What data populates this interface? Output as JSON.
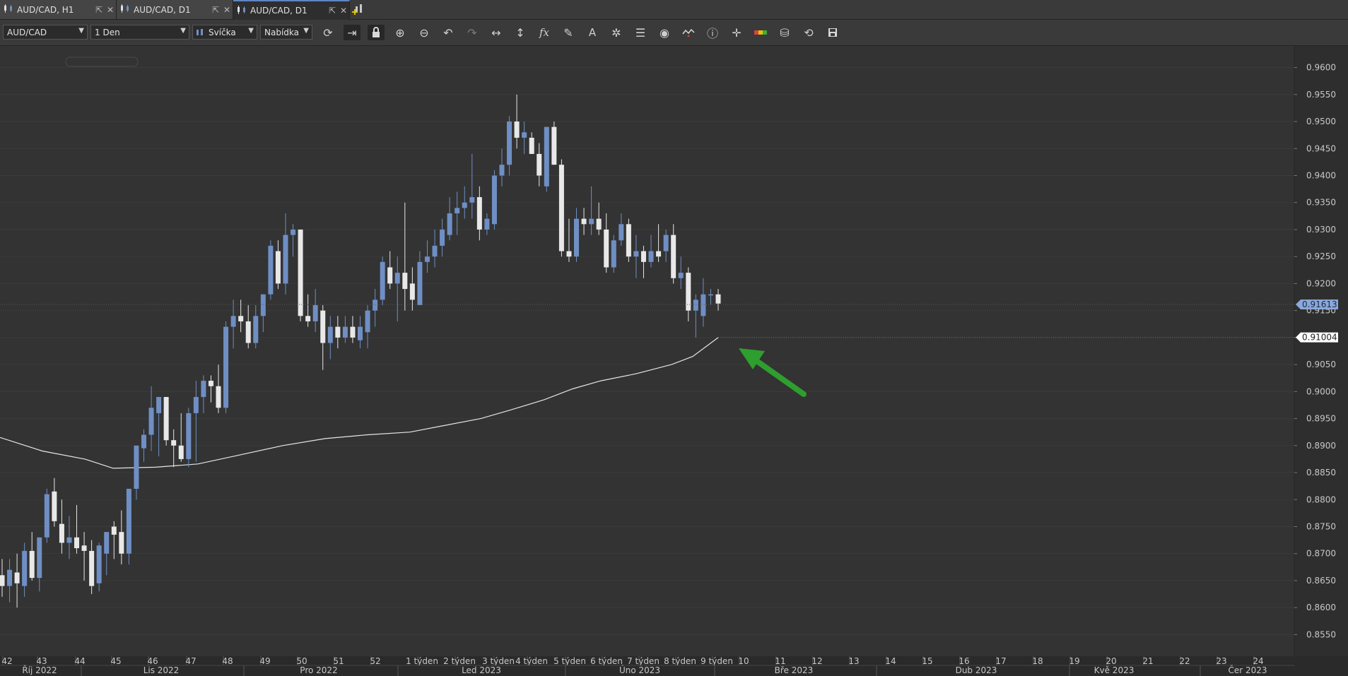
{
  "tabs": [
    {
      "label": "AUD/CAD, H1",
      "active": false
    },
    {
      "label": "AUD/CAD, D1",
      "active": false
    },
    {
      "label": "AUD/CAD, D1",
      "active": true
    }
  ],
  "toolbar": {
    "symbol": "AUD/CAD",
    "timeframe": "1 Den",
    "chart_type": "Svíčka",
    "price_type": "Nabídka",
    "icons": [
      "refresh-icon",
      "autoscroll-icon",
      "lock-icon",
      "zoom-in-icon",
      "zoom-out-icon",
      "undo-icon",
      "redo-icon",
      "horizontal-scale-icon",
      "vertical-scale-icon",
      "fx-indicator-icon",
      "pencil-icon",
      "text-icon",
      "objects-icon",
      "layers-icon",
      "eye-icon",
      "chart-settings-icon",
      "info-icon",
      "crosshair-icon",
      "color-bar-icon",
      "paint-bucket-icon",
      "sync-icon",
      "save-icon"
    ]
  },
  "colors": {
    "bull": "#6f8fc4",
    "bear": "#e8e8e8",
    "ma_line": "#e6e6e6",
    "arrow": "#2e9e2e",
    "badge": "#8aa8d8"
  },
  "chart_data": {
    "type": "candlestick",
    "symbol": "AUD/CAD",
    "timeframe": "D1",
    "ylim": [
      0.851,
      0.964
    ],
    "y_ticks": [
      "0.9600",
      "0.9550",
      "0.9500",
      "0.9450",
      "0.9400",
      "0.9350",
      "0.9300",
      "0.9250",
      "0.9200",
      "0.9150",
      "0.9100",
      "0.9050",
      "0.9000",
      "0.8950",
      "0.8900",
      "0.8850",
      "0.8800",
      "0.8750",
      "0.8700",
      "0.8650",
      "0.8600",
      "0.8550"
    ],
    "current_price": "0.91613",
    "ma_value": "0.91004",
    "week_labels": [
      "42",
      "43",
      "44",
      "45",
      "46",
      "47",
      "48",
      "49",
      "50",
      "51",
      "52",
      "1 týden",
      "2 týden",
      "3 týden",
      "4 týden",
      "5 týden",
      "6 týden",
      "7 týden",
      "8 týden",
      "9 týden",
      "10",
      "11",
      "12",
      "13",
      "14",
      "15",
      "16",
      "17",
      "18",
      "19",
      "20",
      "21",
      "22",
      "23",
      "24"
    ],
    "month_labels": [
      "Říj 2022",
      "Lis 2022",
      "Pro 2022",
      "Led 2023",
      "Úno 2023",
      "Bře 2023",
      "Dub 2023",
      "Kvě 2023",
      "Čer 2023"
    ],
    "candles": [
      [
        0.866,
        0.869,
        0.862,
        0.864
      ],
      [
        0.864,
        0.869,
        0.861,
        0.867
      ],
      [
        0.8665,
        0.87,
        0.86,
        0.8645
      ],
      [
        0.864,
        0.872,
        0.862,
        0.8705
      ],
      [
        0.8705,
        0.874,
        0.865,
        0.8655
      ],
      [
        0.8655,
        0.873,
        0.863,
        0.873
      ],
      [
        0.873,
        0.882,
        0.872,
        0.881
      ],
      [
        0.8815,
        0.884,
        0.875,
        0.876
      ],
      [
        0.8755,
        0.88,
        0.87,
        0.872
      ],
      [
        0.872,
        0.877,
        0.869,
        0.873
      ],
      [
        0.873,
        0.879,
        0.87,
        0.871
      ],
      [
        0.8715,
        0.874,
        0.865,
        0.8705
      ],
      [
        0.8705,
        0.8725,
        0.8625,
        0.864
      ],
      [
        0.8645,
        0.872,
        0.863,
        0.8715
      ],
      [
        0.87,
        0.874,
        0.866,
        0.874
      ],
      [
        0.875,
        0.876,
        0.869,
        0.8735
      ],
      [
        0.874,
        0.878,
        0.868,
        0.87
      ],
      [
        0.87,
        0.881,
        0.868,
        0.882
      ],
      [
        0.882,
        0.89,
        0.88,
        0.89
      ],
      [
        0.8895,
        0.893,
        0.887,
        0.892
      ],
      [
        0.892,
        0.901,
        0.889,
        0.897
      ],
      [
        0.896,
        0.899,
        0.888,
        0.899
      ],
      [
        0.899,
        0.899,
        0.89,
        0.891
      ],
      [
        0.891,
        0.893,
        0.886,
        0.89
      ],
      [
        0.89,
        0.896,
        0.887,
        0.8875
      ],
      [
        0.8875,
        0.897,
        0.886,
        0.896
      ],
      [
        0.896,
        0.902,
        0.887,
        0.899
      ],
      [
        0.899,
        0.903,
        0.896,
        0.902
      ],
      [
        0.902,
        0.903,
        0.898,
        0.901
      ],
      [
        0.901,
        0.905,
        0.896,
        0.897
      ],
      [
        0.897,
        0.913,
        0.896,
        0.912
      ],
      [
        0.912,
        0.917,
        0.908,
        0.914
      ],
      [
        0.914,
        0.917,
        0.911,
        0.913
      ],
      [
        0.913,
        0.916,
        0.908,
        0.909
      ],
      [
        0.909,
        0.916,
        0.908,
        0.914
      ],
      [
        0.914,
        0.918,
        0.911,
        0.918
      ],
      [
        0.918,
        0.928,
        0.917,
        0.927
      ],
      [
        0.926,
        0.928,
        0.919,
        0.92
      ],
      [
        0.92,
        0.933,
        0.918,
        0.929
      ],
      [
        0.929,
        0.931,
        0.925,
        0.93
      ],
      [
        0.93,
        0.93,
        0.913,
        0.914
      ],
      [
        0.914,
        0.918,
        0.912,
        0.913
      ],
      [
        0.913,
        0.919,
        0.911,
        0.916
      ],
      [
        0.915,
        0.916,
        0.904,
        0.909
      ],
      [
        0.909,
        0.914,
        0.906,
        0.912
      ],
      [
        0.912,
        0.914,
        0.908,
        0.91
      ],
      [
        0.91,
        0.914,
        0.909,
        0.912
      ],
      [
        0.912,
        0.914,
        0.909,
        0.91
      ],
      [
        0.9095,
        0.914,
        0.908,
        0.912
      ],
      [
        0.911,
        0.916,
        0.908,
        0.915
      ],
      [
        0.915,
        0.919,
        0.912,
        0.917
      ],
      [
        0.917,
        0.925,
        0.916,
        0.924
      ],
      [
        0.923,
        0.926,
        0.919,
        0.92
      ],
      [
        0.92,
        0.925,
        0.913,
        0.922
      ],
      [
        0.922,
        0.935,
        0.915,
        0.919
      ],
      [
        0.92,
        0.923,
        0.915,
        0.917
      ],
      [
        0.916,
        0.926,
        0.916,
        0.924
      ],
      [
        0.924,
        0.928,
        0.922,
        0.925
      ],
      [
        0.925,
        0.93,
        0.923,
        0.927
      ],
      [
        0.927,
        0.932,
        0.925,
        0.93
      ],
      [
        0.929,
        0.936,
        0.928,
        0.933
      ],
      [
        0.933,
        0.937,
        0.929,
        0.934
      ],
      [
        0.934,
        0.938,
        0.932,
        0.935
      ],
      [
        0.935,
        0.944,
        0.932,
        0.936
      ],
      [
        0.936,
        0.938,
        0.928,
        0.93
      ],
      [
        0.93,
        0.933,
        0.929,
        0.932
      ],
      [
        0.931,
        0.941,
        0.93,
        0.94
      ],
      [
        0.94,
        0.945,
        0.938,
        0.942
      ],
      [
        0.942,
        0.951,
        0.94,
        0.95
      ],
      [
        0.95,
        0.955,
        0.945,
        0.947
      ],
      [
        0.947,
        0.95,
        0.944,
        0.948
      ],
      [
        0.947,
        0.948,
        0.944,
        0.944
      ],
      [
        0.944,
        0.946,
        0.938,
        0.94
      ],
      [
        0.938,
        0.949,
        0.937,
        0.949
      ],
      [
        0.949,
        0.95,
        0.942,
        0.942
      ],
      [
        0.942,
        0.943,
        0.925,
        0.926
      ],
      [
        0.926,
        0.932,
        0.924,
        0.925
      ],
      [
        0.925,
        0.934,
        0.924,
        0.932
      ],
      [
        0.932,
        0.934,
        0.929,
        0.931
      ],
      [
        0.931,
        0.938,
        0.929,
        0.932
      ],
      [
        0.932,
        0.935,
        0.929,
        0.93
      ],
      [
        0.93,
        0.933,
        0.922,
        0.923
      ],
      [
        0.923,
        0.929,
        0.922,
        0.928
      ],
      [
        0.928,
        0.933,
        0.927,
        0.931
      ],
      [
        0.931,
        0.932,
        0.924,
        0.925
      ],
      [
        0.925,
        0.929,
        0.921,
        0.926
      ],
      [
        0.926,
        0.927,
        0.921,
        0.924
      ],
      [
        0.924,
        0.929,
        0.923,
        0.926
      ],
      [
        0.926,
        0.931,
        0.924,
        0.925
      ],
      [
        0.926,
        0.93,
        0.924,
        0.929
      ],
      [
        0.929,
        0.931,
        0.92,
        0.921
      ],
      [
        0.921,
        0.925,
        0.919,
        0.922
      ],
      [
        0.922,
        0.923,
        0.913,
        0.915
      ],
      [
        0.915,
        0.918,
        0.91,
        0.917
      ],
      [
        0.914,
        0.921,
        0.912,
        0.918
      ],
      [
        0.918,
        0.919,
        0.916,
        0.918
      ],
      [
        0.918,
        0.919,
        0.915,
        0.9163
      ]
    ],
    "ma": [
      [
        0,
        0.8915
      ],
      [
        60,
        0.889
      ],
      [
        120,
        0.8875
      ],
      [
        160,
        0.8858
      ],
      [
        220,
        0.886
      ],
      [
        280,
        0.8866
      ],
      [
        330,
        0.888
      ],
      [
        400,
        0.89
      ],
      [
        460,
        0.8913
      ],
      [
        520,
        0.892
      ],
      [
        580,
        0.8925
      ],
      [
        620,
        0.8935
      ],
      [
        680,
        0.895
      ],
      [
        720,
        0.8965
      ],
      [
        770,
        0.8985
      ],
      [
        810,
        0.9005
      ],
      [
        850,
        0.902
      ],
      [
        900,
        0.9033
      ],
      [
        950,
        0.905
      ],
      [
        980,
        0.9065
      ],
      [
        1016,
        0.91
      ]
    ]
  }
}
